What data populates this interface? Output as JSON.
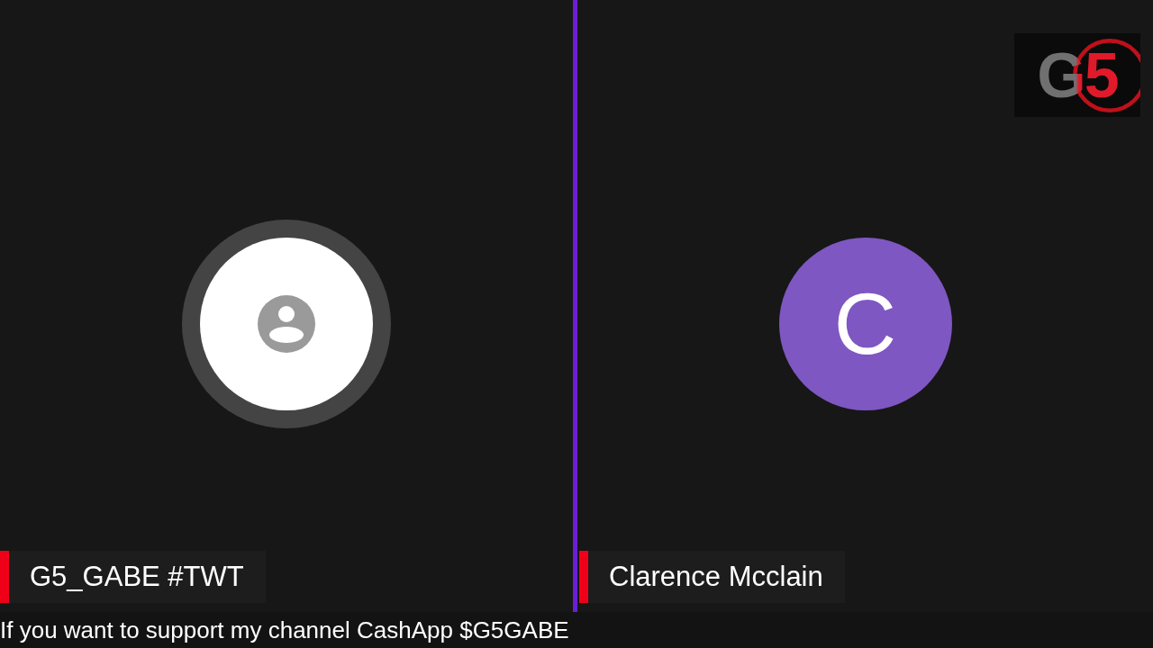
{
  "logo": {
    "text": "G5"
  },
  "participants": [
    {
      "name": "G5_GABE #TWT",
      "speaking": true,
      "avatar": {
        "kind": "icon"
      }
    },
    {
      "name": "Clarence Mcclain",
      "speaking": false,
      "avatar": {
        "kind": "letter",
        "letter": "C",
        "color": "#7e57c2"
      }
    }
  ],
  "ticker": "If you want to support my channel CashApp $G5GABE"
}
